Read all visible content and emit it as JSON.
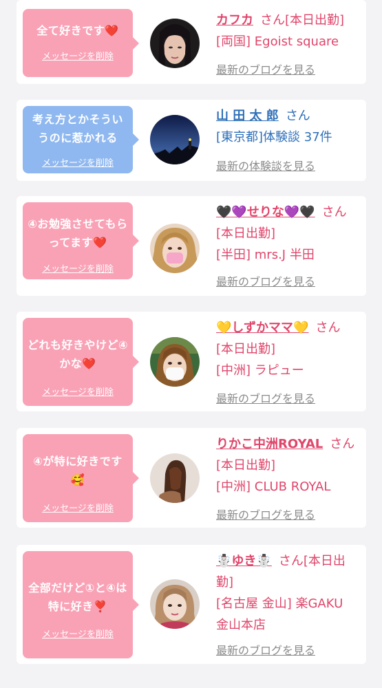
{
  "delete_label": "メッセージを削除",
  "san": "さん",
  "cards": [
    {
      "message": "全て好きです❤️",
      "name": "カフカ",
      "status": "[本日出勤]",
      "location": "[両国] Egoist square",
      "link": "最新のブログを見る"
    },
    {
      "message": "考え方とかそういうのに惹かれる",
      "name": "山 田 太 郎",
      "location": "[東京都]体験談 37件",
      "link": "最新の体験談を見る"
    },
    {
      "message": "④お勉強させてもらってます❤️",
      "name": "🖤💜せりな💜🖤",
      "status": "[本日出勤]",
      "location": "[半田] mrs.J 半田",
      "link": "最新のブログを見る"
    },
    {
      "message": "どれも好きやけど④かな❤️",
      "name": "💛しずかママ💛",
      "status": "[本日出勤]",
      "location": "[中洲] ラピュー",
      "link": "最新のブログを見る"
    },
    {
      "message": "④が特に好きです🥰",
      "name": "りかこ中洲ROYAL",
      "status": "[本日出勤]",
      "location": "[中洲] CLUB ROYAL",
      "link": "最新のブログを見る"
    },
    {
      "message": "全部だけど①と④は特に好き❣️",
      "name": "☃️ゆき☃️",
      "status": "[本日出勤]",
      "location": "[名古屋 金山] 楽GAKU 金山本店",
      "link": "最新のブログを見る"
    }
  ],
  "colors": {
    "pink": "#f9a2b6",
    "blue": "#8fb8f0",
    "name_pink": "#e0456a",
    "name_blue": "#2e6fb8",
    "link_gray": "#8b8b8b"
  }
}
